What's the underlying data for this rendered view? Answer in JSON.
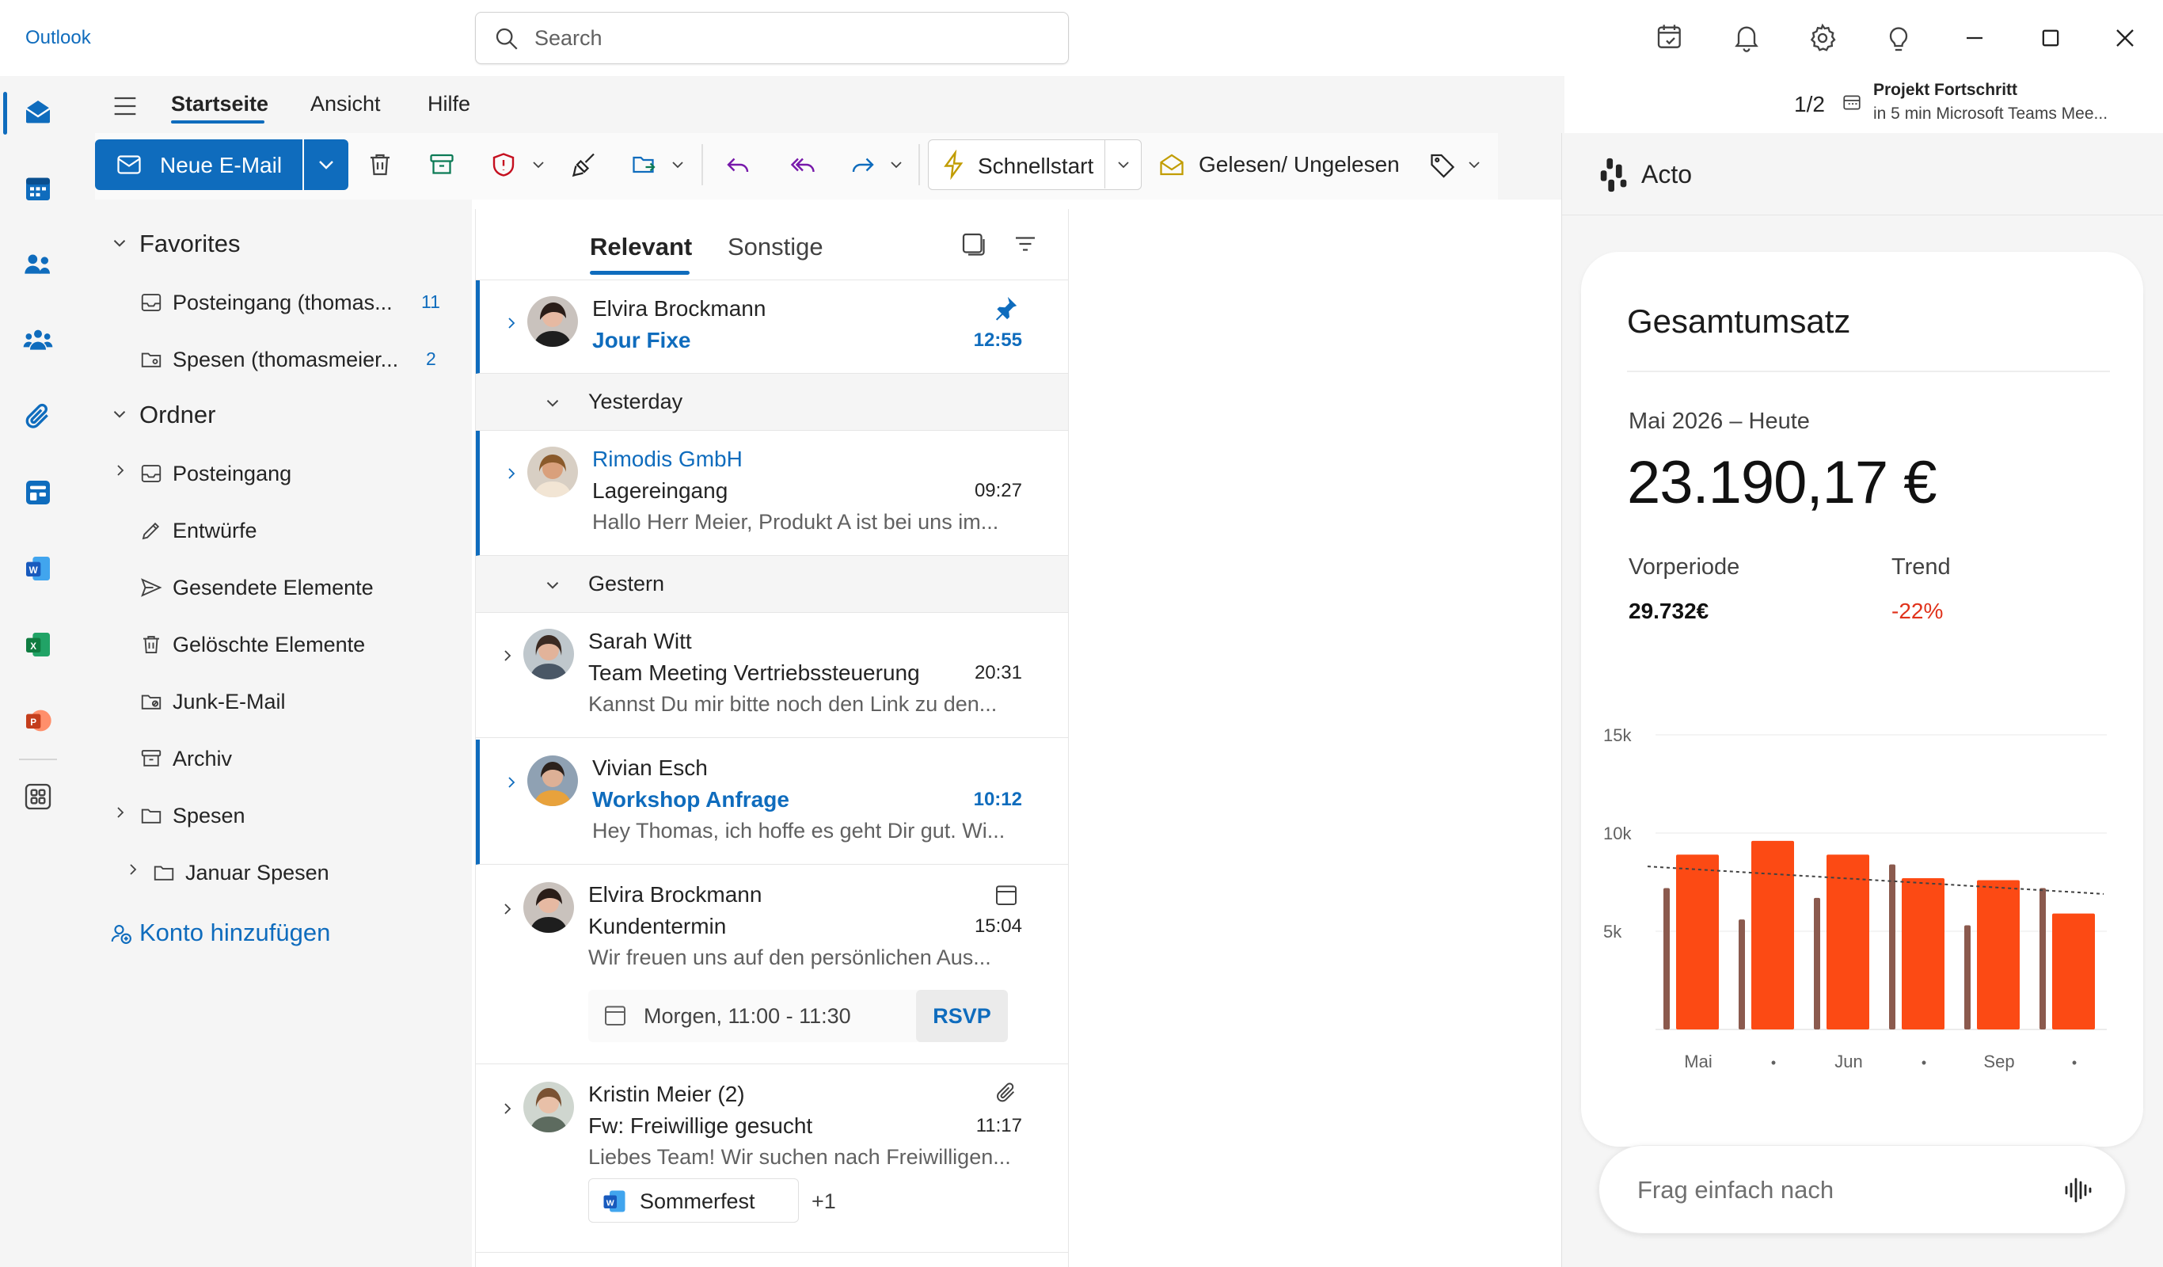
{
  "app": {
    "title": "Outlook"
  },
  "search": {
    "placeholder": "Search"
  },
  "ribbon": {
    "tabs": [
      "Startseite",
      "Ansicht",
      "Hilfe"
    ],
    "new_mail": "Neue E-Mail",
    "quickstart": "Schnellstart",
    "read_unread": "Gelesen/ Ungelesen"
  },
  "reminder": {
    "count": "1/2",
    "title": "Projekt Fortschritt",
    "subtitle": "in 5 min Microsoft Teams Mee..."
  },
  "folders": {
    "favorites_label": "Favorites",
    "favorites": [
      {
        "label": "Posteingang (thomas...",
        "count": "11"
      },
      {
        "label": "Spesen (thomasmeier...",
        "count": "2"
      }
    ],
    "folders_label": "Ordner",
    "items": [
      {
        "label": "Posteingang"
      },
      {
        "label": "Entwürfe"
      },
      {
        "label": "Gesendete Elemente"
      },
      {
        "label": "Gelöschte Elemente"
      },
      {
        "label": "Junk-E-Mail"
      },
      {
        "label": "Archiv"
      },
      {
        "label": "Spesen"
      },
      {
        "label": "Januar Spesen"
      }
    ],
    "add_account": "Konto hinzufügen"
  },
  "message_list": {
    "tabs": [
      "Relevant",
      "Sonstige"
    ],
    "groups": [
      "Yesterday",
      "Gestern"
    ],
    "messages": [
      {
        "sender": "Elvira Brockmann",
        "subject": "Jour Fixe",
        "time": "12:55",
        "preview": ""
      },
      {
        "sender": "Rimodis GmbH",
        "subject": "Lagereingang",
        "time": "09:27",
        "preview": "Hallo Herr Meier, Produkt A ist bei uns im..."
      },
      {
        "sender": "Sarah Witt",
        "subject": "Team Meeting Vertriebssteuerung",
        "time": "20:31",
        "preview": "Kannst Du mir bitte noch den Link zu den..."
      },
      {
        "sender": "Vivian Esch",
        "subject": "Workshop Anfrage",
        "time": "10:12",
        "preview": "Hey Thomas, ich hoffe es geht Dir gut. Wi..."
      },
      {
        "sender": "Elvira Brockmann",
        "subject": "Kundentermin",
        "time": "15:04",
        "preview": "Wir freuen uns auf den persönlichen Aus...",
        "event": "Morgen, 11:00 - 11:30",
        "event_action": "RSVP"
      },
      {
        "sender": "Kristin Meier (2)",
        "subject": "Fw: Freiwillige gesucht",
        "time": "11:17",
        "preview": "Liebes Team! Wir suchen nach Freiwilligen...",
        "attachment": "Sommerfest",
        "attachment_more": "+1"
      }
    ]
  },
  "acto": {
    "title": "Acto",
    "card_title": "Gesamtumsatz",
    "period": "Mai 2026 – Heute",
    "total": "23.190,17 €",
    "prev_label": "Vorperiode",
    "prev_value": "29.732€",
    "trend_label": "Trend",
    "trend_value": "-22%",
    "ask_placeholder": "Frag einfach nach"
  },
  "colors": {
    "accent": "#0f6cbd",
    "bar_current": "#fc4a14",
    "bar_previous": "#8b5a4e",
    "trend_negative": "#e0321b"
  },
  "chart_data": {
    "type": "bar",
    "title": "",
    "y_ticks": [
      "15k",
      "10k",
      "5k"
    ],
    "ylim": [
      0,
      15000
    ],
    "x_tick_labels": [
      "Mai",
      "•",
      "Jun",
      "•",
      "Sep",
      "•"
    ],
    "categories": [
      "1",
      "2",
      "3",
      "4",
      "5",
      "6"
    ],
    "series": [
      {
        "values": [
          7200,
          5600,
          6700,
          8400,
          5300,
          7200
        ]
      },
      {
        "values": [
          8900,
          9600,
          8900,
          7700,
          7600,
          5900
        ]
      }
    ],
    "trendline": {
      "start": 8300,
      "end": 6900
    },
    "grid": true
  }
}
